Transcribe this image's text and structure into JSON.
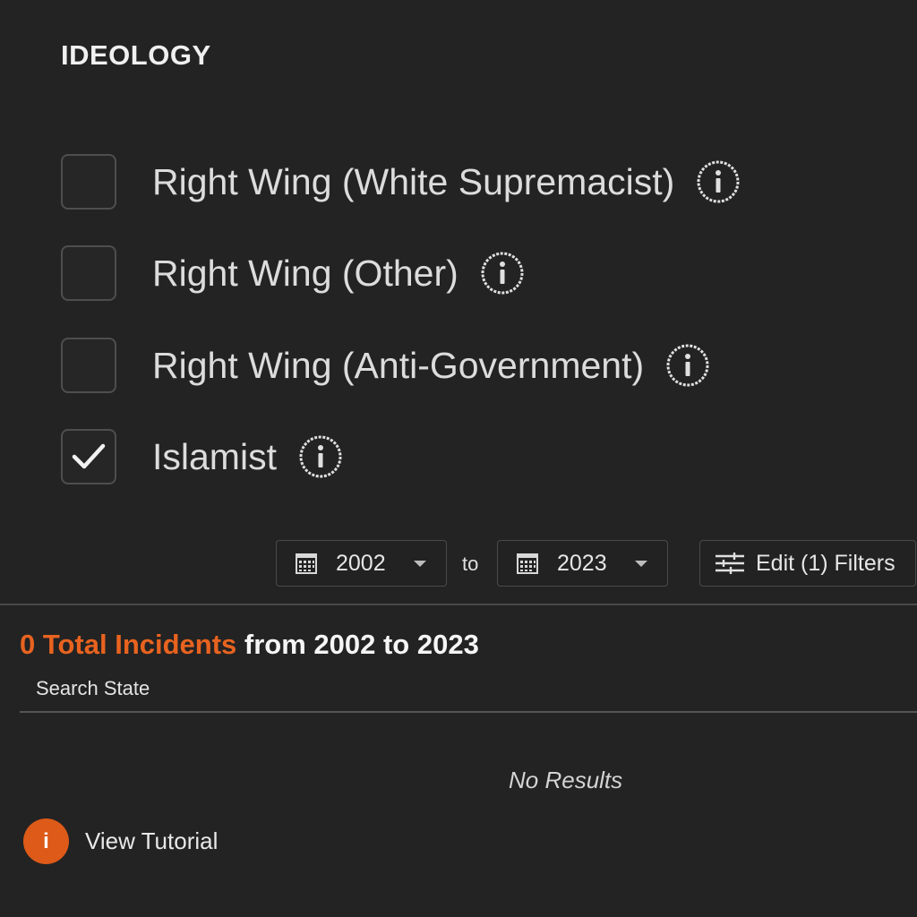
{
  "filters": {
    "section_title": "IDEOLOGY",
    "options": [
      {
        "label": "Right Wing (White Supremacist)",
        "checked": false
      },
      {
        "label": "Right Wing (Other)",
        "checked": false
      },
      {
        "label": "Right Wing (Anti-Government)",
        "checked": false
      },
      {
        "label": "Islamist",
        "checked": true
      }
    ],
    "info_icon": "info-icon"
  },
  "range": {
    "start_year": "2002",
    "to_label": "to",
    "end_year": "2023",
    "edit_label": "Edit (1) Filters"
  },
  "results": {
    "total_highlight": "0 Total Incidents",
    "total_rest": " from 2002 to 2023",
    "search_state_label": "Search State",
    "no_results": "No Results"
  },
  "tutorial": {
    "icon_glyph": "i",
    "label": "View Tutorial"
  },
  "colors": {
    "background": "#232323",
    "accent": "#e8631f"
  }
}
